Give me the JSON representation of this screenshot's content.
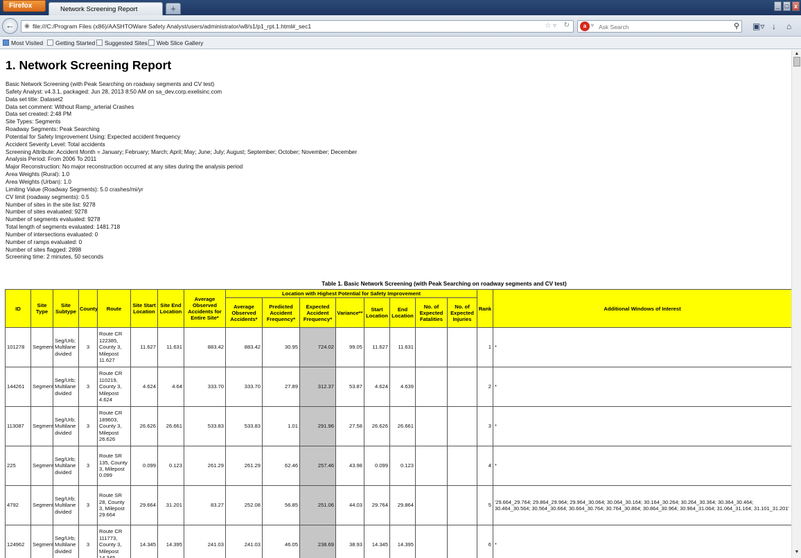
{
  "browser": {
    "app_button": "Firefox",
    "tab_title": "Network Screening Report",
    "new_tab": "+",
    "window_controls": {
      "minimize": "_",
      "maximize": "□",
      "close": "x"
    },
    "url": "file:///C:/Program Files (x86)/AASHTOWare Safety Analyst/users/administrator/w8/s1/p1_rpt.1.html#_sec1",
    "search_placeholder": "Ask Search",
    "bookmarks": [
      "Most Visited",
      "Getting Started",
      "Suggested Sites",
      "Web Slice Gallery"
    ]
  },
  "report": {
    "title": "1.  Network Screening Report",
    "info_lines": [
      "Basic Network Screening (with Peak Searching on roadway segments and CV test)",
      "Safety Analyst: v4.3.1, packaged: Jun 28, 2013 8:50 AM on sa_dev.corp.exelisinc.com",
      "Data set title: Dataset2",
      "Data set comment: Without Ramp_arterial Crashes",
      "Data set created: 2:48 PM",
      "Site Types: Segments",
      "Roadway Segments: Peak Searching",
      "Potential for Safety Improvement Using: Expected accident frequency",
      "Accident Severity Level: Total accidents",
      "Screening Attribute: Accident Month = January; February; March; April; May; June; July; August; September; October; November; December",
      "Analysis Period: From 2006 To 2011",
      "Major Reconstruction: No major reconstruction occurred at any sites during the analysis period",
      "Area Weights (Rural): 1.0",
      "Area Weights (Urban): 1.0",
      "Limiting Value (Roadway Segments): 5.0 crashes/mi/yr",
      "CV limit (roadway segments): 0.5",
      "Number of sites in the site list: 9278",
      "Number of sites evaluated: 9278",
      "Number of segments evaluated: 9278",
      "Total length of segments evaluated: 1481.718",
      "Number of intersections evaluated: 0",
      "Number of ramps evaluated: 0",
      "Number of sites flagged: 2898",
      "Screening time: 2 minutes, 50 seconds"
    ],
    "table_caption": "Table 1. Basic Network Screening (with Peak Searching on roadway segments and CV test)",
    "headers": {
      "id": "ID",
      "site_type": "Site Type",
      "site_subtype": "Site Subtype",
      "county": "County",
      "route": "Route",
      "site_start": "Site Start Location",
      "site_end": "Site End Location",
      "avg_obs_entire": "Average Observed Accidents for Entire Site*",
      "group": "Location with Highest Potential for Safety Improvement",
      "avg_obs": "Average Observed Accidents*",
      "predicted": "Predicted Accident Frequency*",
      "expected": "Expected Accident Frequency*",
      "variance": "Variance**",
      "start_loc": "Start Location",
      "end_loc": "End Location",
      "fatalities": "No. of Expected Fatalities",
      "injuries": "No. of Expected Injuries",
      "rank": "Rank",
      "additional": "Additional Windows of Interest"
    },
    "rows": [
      {
        "id": "101278",
        "type": "Segment",
        "subtype": "Seg/Urb; Multilane divided",
        "county": "3",
        "route": "Route CR 122385, County 3, Milepost 11.627",
        "site_start": "11.627",
        "site_end": "11.631",
        "avg_entire": "883.42",
        "avg_obs": "883.42",
        "predicted": "30.95",
        "expected": "724.02",
        "variance": "99.05",
        "start": "11.627",
        "end": "11.631",
        "fatalities": "",
        "injuries": "",
        "rank": "1",
        "additional": "*"
      },
      {
        "id": "144261",
        "type": "Segment",
        "subtype": "Seg/Urb; Multilane divided",
        "county": "3",
        "route": "Route CR 110219, County 3, Milepost 4.624",
        "site_start": "4.624",
        "site_end": "4.64",
        "avg_entire": "333.70",
        "avg_obs": "333.70",
        "predicted": "27.89",
        "expected": "312.37",
        "variance": "53.87",
        "start": "4.624",
        "end": "4.639",
        "fatalities": "",
        "injuries": "",
        "rank": "2",
        "additional": "*"
      },
      {
        "id": "113087",
        "type": "Segment",
        "subtype": "Seg/Urb; Multilane divided",
        "county": "3",
        "route": "Route CR 189603, County 3, Milepost 26.626",
        "site_start": "26.626",
        "site_end": "26.661",
        "avg_entire": "533.83",
        "avg_obs": "533.83",
        "predicted": "1.01",
        "expected": "291.96",
        "variance": "27.58",
        "start": "26.626",
        "end": "26.661",
        "fatalities": "",
        "injuries": "",
        "rank": "3",
        "additional": "*"
      },
      {
        "id": "225",
        "type": "Segment",
        "subtype": "Seg/Urb; Multilane divided",
        "county": "3",
        "route": "Route SR 135, County 3, Milepost 0.099",
        "site_start": "0.099",
        "site_end": "0.123",
        "avg_entire": "261.29",
        "avg_obs": "261.29",
        "predicted": "62.46",
        "expected": "257.46",
        "variance": "43.98",
        "start": "0.099",
        "end": "0.123",
        "fatalities": "",
        "injuries": "",
        "rank": "4",
        "additional": "*"
      },
      {
        "id": "4792",
        "type": "Segment",
        "subtype": "Seg/Urb; Multilane divided",
        "county": "3",
        "route": "Route SR 28, County 3, Milepost 29.664",
        "site_start": "29.664",
        "site_end": "31.201",
        "avg_entire": "83.27",
        "avg_obs": "252.08",
        "predicted": "56.85",
        "expected": "251.06",
        "variance": "44.03",
        "start": "29.764",
        "end": "29.864",
        "fatalities": "",
        "injuries": "",
        "rank": "5",
        "additional": "'29.664_29.764; 29.864_29.964; 29.964_30.064; 30.064_30.164; 30.164_30.264; 30.264_30.364; 30.364_30.464; 30.464_30.564; 30.564_30.664; 30.664_30.764; 30.764_30.864; 30.864_30.964; 30.964_31.064; 31.064_31.164; 31.101_31.201'"
      },
      {
        "id": "124962",
        "type": "Segment",
        "subtype": "Seg/Urb; Multilane divided",
        "county": "3",
        "route": "Route CR 111773, County 3, Milepost 14.345",
        "site_start": "14.345",
        "site_end": "14.395",
        "avg_entire": "241.03",
        "avg_obs": "241.03",
        "predicted": "46.05",
        "expected": "238.69",
        "variance": "38.93",
        "start": "14.345",
        "end": "14.395",
        "fatalities": "",
        "injuries": "",
        "rank": "6",
        "additional": "*"
      }
    ]
  },
  "colors": {
    "header_bg": "#ffff00",
    "highlight_col": "#c6c6c6"
  },
  "icons": [
    "back-icon",
    "page-icon",
    "bookmark-star-icon",
    "reload-icon",
    "search-engine-icon",
    "search-icon",
    "bookmarks-menu-icon",
    "download-icon",
    "home-icon"
  ]
}
